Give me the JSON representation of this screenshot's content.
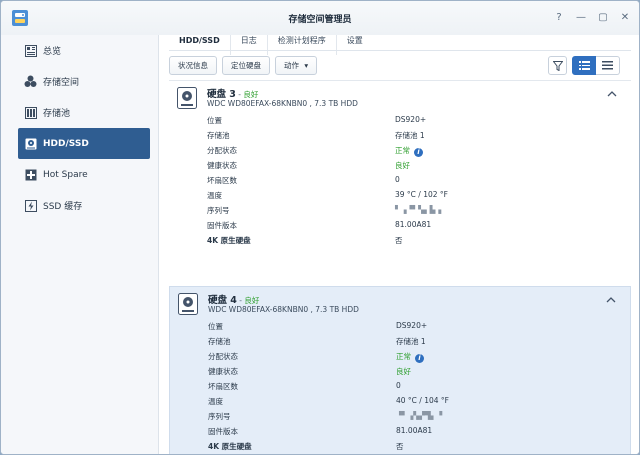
{
  "window": {
    "title": "存储空间管理员",
    "controls": {
      "help": "?",
      "minimize": "—",
      "maximize": "▢",
      "close": "✕"
    }
  },
  "sidebar": {
    "items": [
      {
        "label": "总览",
        "icon": "overview-icon",
        "active": false
      },
      {
        "label": "存储空间",
        "icon": "storage-space-icon",
        "active": false
      },
      {
        "label": "存储池",
        "icon": "storage-pool-icon",
        "active": false
      },
      {
        "label": "HDD/SSD",
        "icon": "disk-icon",
        "active": true
      },
      {
        "label": "Hot Spare",
        "icon": "hot-spare-icon",
        "active": false
      },
      {
        "label": "SSD 缓存",
        "icon": "ssd-cache-icon",
        "active": false
      }
    ]
  },
  "tabs": [
    {
      "label": "HDD/SSD",
      "active": true
    },
    {
      "label": "日志",
      "active": false
    },
    {
      "label": "检测计划程序",
      "active": false
    },
    {
      "label": "设置",
      "active": false
    }
  ],
  "toolbar": {
    "status_info": "状况信息",
    "locate_disk": "定位硬盘",
    "action": "动作",
    "action_arrow": "▾"
  },
  "labels": {
    "location": "位置",
    "pool": "存储池",
    "alloc": "分配状态",
    "health": "健康状态",
    "bad_sectors": "坏扇区数",
    "temperature": "温度",
    "serial": "序列号",
    "firmware": "固件版本",
    "native_4k": "4K 原生硬盘"
  },
  "disks": [
    {
      "name": "硬盘 3",
      "sep": " - ",
      "status": "良好",
      "model": "WDC WD80EFAX-68KNBN0 , 7.3 TB HDD",
      "location": "DS920+",
      "pool": "存储池 1",
      "alloc": "正常",
      "health": "良好",
      "bad_sectors": "0",
      "temperature": "39 °C / 102 °F",
      "serial": "▘▗▝▘▚▖▙▗",
      "firmware": "81.00A81",
      "native_4k": "否"
    },
    {
      "name": "硬盘 4",
      "sep": " - ",
      "status": "良好",
      "model": "WDC WD80EFAX-68KNBN0 , 7.3 TB HDD",
      "location": "DS920+",
      "pool": "存储池 1",
      "alloc": "正常",
      "health": "良好",
      "bad_sectors": "0",
      "temperature": "40 °C / 104 °F",
      "serial": "▝▘▗▚▞▜▖▝",
      "firmware": "81.00A81",
      "native_4k": "否"
    }
  ],
  "colors": {
    "accent": "#2f5d91",
    "good": "#2d9e2d",
    "selected_bg": "#e4edf8"
  }
}
